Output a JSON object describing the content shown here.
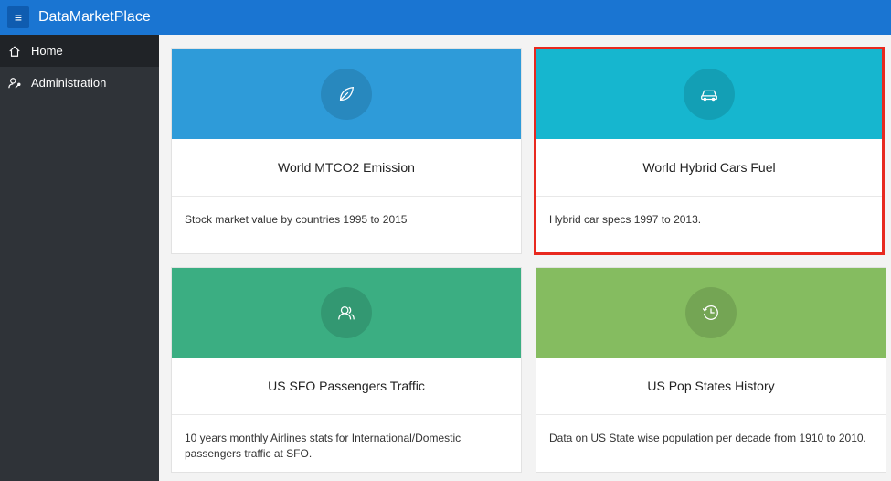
{
  "app": {
    "title": "DataMarketPlace",
    "menu_icon": "hamburger-icon"
  },
  "sidebar": {
    "items": [
      {
        "label": "Home",
        "icon": "home-icon",
        "active": true
      },
      {
        "label": "Administration",
        "icon": "user-settings-icon",
        "active": false
      }
    ]
  },
  "cards": [
    {
      "title": "World MTCO2 Emission",
      "description": "Stock market value by countries 1995 to 2015",
      "icon": "leaf-icon",
      "color": "#2e9bd9"
    },
    {
      "title": "World Hybrid Cars Fuel",
      "description": "Hybrid car specs 1997 to 2013.",
      "icon": "car-icon",
      "color": "#16b6cf",
      "highlighted": true
    },
    {
      "title": "US SFO Passengers Traffic",
      "description": "10 years monthly Airlines stats for International/Domestic passengers traffic at SFO.",
      "icon": "users-icon",
      "color": "#3bae82"
    },
    {
      "title": "US Pop States History",
      "description": "Data on US State wise population per decade from 1910 to 2010.",
      "icon": "history-clock-icon",
      "color": "#85bc60"
    }
  ],
  "colors": {
    "topbar": "#1a75d2",
    "sidebar": "#2f3338",
    "highlight_border": "#e8291f"
  }
}
